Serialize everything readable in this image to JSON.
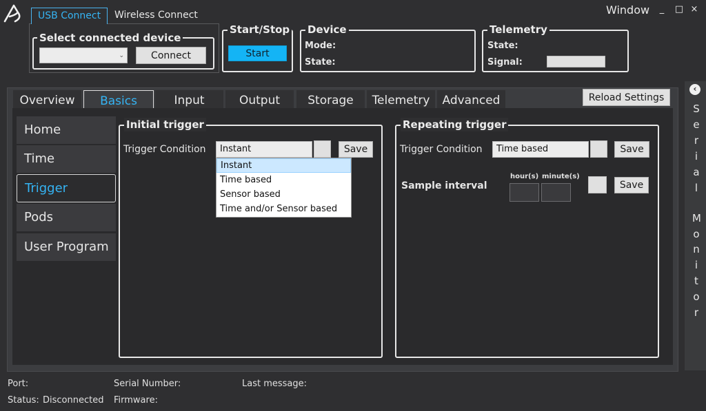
{
  "window": {
    "title": "Window",
    "min": "_",
    "max": "□",
    "close": "×"
  },
  "connection": {
    "tabs": [
      "USB Connect",
      "Wireless Connect"
    ],
    "select_title": "Select connected device",
    "select_value": "",
    "connect_label": "Connect"
  },
  "start_stop": {
    "title": "Start/Stop",
    "button": "Start"
  },
  "device": {
    "title": "Device",
    "mode_label": "Mode:",
    "state_label": "State:"
  },
  "telemetry": {
    "title": "Telemetry",
    "state_label": "State:",
    "signal_label": "Signal:"
  },
  "tabs": [
    "Overview",
    "Basics",
    "Input",
    "Output",
    "Storage",
    "Telemetry",
    "Advanced"
  ],
  "reload_label": "Reload Settings",
  "sidebar": [
    "Home",
    "Time",
    "Trigger",
    "Pods",
    "User Program"
  ],
  "initial_trigger": {
    "title": "Initial trigger",
    "condition_label": "Trigger Condition",
    "condition_value": "Instant",
    "save_label": "Save",
    "options": [
      "Instant",
      "Time based",
      "Sensor based",
      "Time and/or Sensor based"
    ]
  },
  "repeating_trigger": {
    "title": "Repeating trigger",
    "condition_label": "Trigger Condition",
    "condition_value": "Time based",
    "save_label": "Save",
    "interval_label": "Sample interval",
    "hours_label": "hour(s)",
    "minutes_label": "minute(s)",
    "save2_label": "Save"
  },
  "serial_monitor": {
    "letters": [
      "S",
      "e",
      "r",
      "i",
      "a",
      "l",
      "M",
      "o",
      "n",
      "i",
      "t",
      "o",
      "r"
    ]
  },
  "status_bar": {
    "port": "Port:",
    "status_label": "Status:",
    "status_value": "Disconnected",
    "serial_number": "Serial Number:",
    "firmware": "Firmware:",
    "last_message": "Last message:"
  },
  "colors": {
    "accent": "#35b4f4",
    "start_button": "#14b4f5"
  }
}
